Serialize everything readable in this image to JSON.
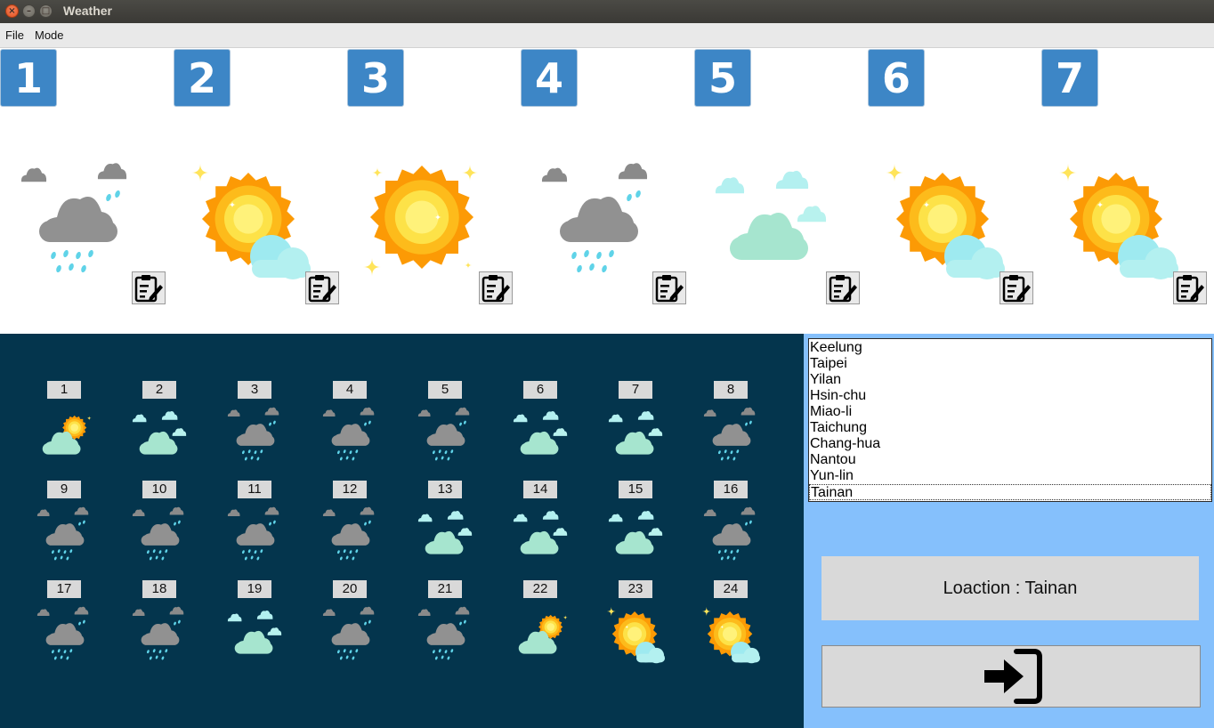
{
  "window": {
    "title": "Weather"
  },
  "menu": [
    {
      "label": "File"
    },
    {
      "label": "Mode"
    }
  ],
  "days": [
    {
      "number": "1",
      "icon": "cloud-rain"
    },
    {
      "number": "2",
      "icon": "sun-cloud"
    },
    {
      "number": "3",
      "icon": "sun"
    },
    {
      "number": "4",
      "icon": "cloud-rain"
    },
    {
      "number": "5",
      "icon": "cloudy"
    },
    {
      "number": "6",
      "icon": "sun-cloud"
    },
    {
      "number": "7",
      "icon": "sun-cloud"
    }
  ],
  "hours": [
    {
      "label": "1",
      "icon": "partly-sunny"
    },
    {
      "label": "2",
      "icon": "cloudy"
    },
    {
      "label": "3",
      "icon": "cloud-rain"
    },
    {
      "label": "4",
      "icon": "cloud-rain"
    },
    {
      "label": "5",
      "icon": "cloud-rain"
    },
    {
      "label": "6",
      "icon": "cloudy"
    },
    {
      "label": "7",
      "icon": "cloudy"
    },
    {
      "label": "8",
      "icon": "cloud-rain"
    },
    {
      "label": "9",
      "icon": "cloud-rain"
    },
    {
      "label": "10",
      "icon": "cloud-rain"
    },
    {
      "label": "11",
      "icon": "cloud-rain"
    },
    {
      "label": "12",
      "icon": "cloud-rain"
    },
    {
      "label": "13",
      "icon": "cloudy"
    },
    {
      "label": "14",
      "icon": "cloudy"
    },
    {
      "label": "15",
      "icon": "cloudy"
    },
    {
      "label": "16",
      "icon": "cloud-rain"
    },
    {
      "label": "17",
      "icon": "cloud-rain"
    },
    {
      "label": "18",
      "icon": "cloud-rain"
    },
    {
      "label": "19",
      "icon": "cloudy"
    },
    {
      "label": "20",
      "icon": "cloud-rain"
    },
    {
      "label": "21",
      "icon": "cloud-rain"
    },
    {
      "label": "22",
      "icon": "partly-sunny"
    },
    {
      "label": "23",
      "icon": "sun-cloud"
    },
    {
      "label": "24",
      "icon": "sun-cloud"
    }
  ],
  "locations": {
    "items": [
      "Keelung",
      "Taipei",
      "Yilan",
      "Hsin-chu",
      "Miao-li",
      "Taichung",
      "Chang-hua",
      "Nantou",
      "Yun-lin",
      "Tainan"
    ],
    "selected": "Tainan"
  },
  "location_display": "Loaction : Tainan",
  "colors": {
    "badge": "#3d86c6",
    "hourly_bg": "#04354d",
    "right_bg": "#85c0fc",
    "sun_outer": "#fc9a05",
    "sun_inner": "#fde248",
    "cloud_grey": "#919191",
    "cloud_mint": "#a6e5cf",
    "cloud_cyan": "#b3f0f0",
    "rain": "#5fd3e8"
  }
}
